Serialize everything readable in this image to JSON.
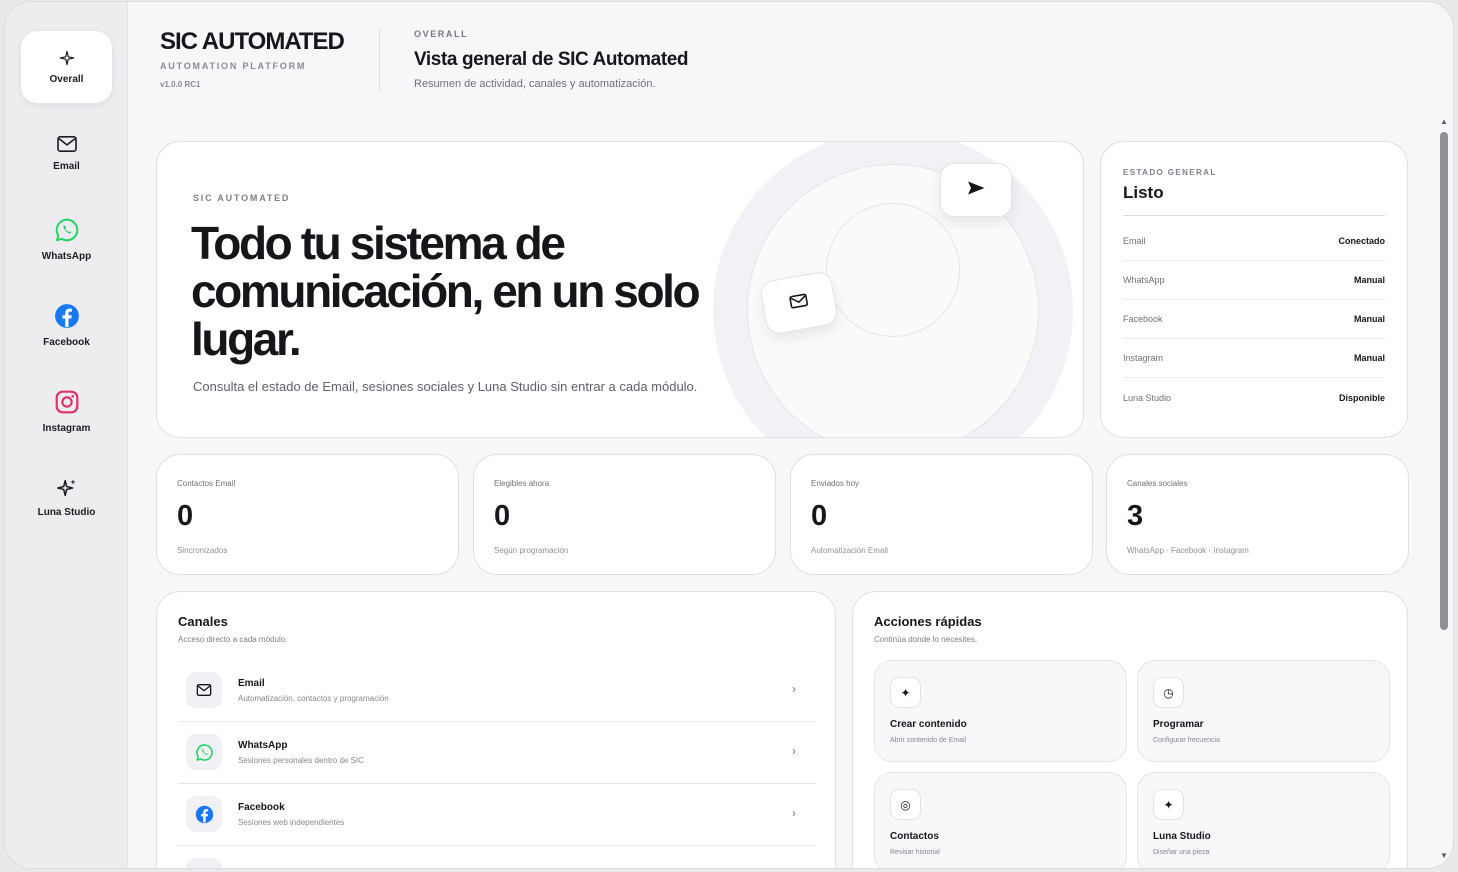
{
  "sidebar": {
    "items": [
      {
        "label": "Overall",
        "icon": "sparkle-icon",
        "active": true
      },
      {
        "label": "Email",
        "icon": "mail-icon"
      },
      {
        "label": "WhatsApp",
        "icon": "whatsapp-icon",
        "color": "#25d366"
      },
      {
        "label": "Facebook",
        "icon": "facebook-icon",
        "color": "#1877f2"
      },
      {
        "label": "Instagram",
        "icon": "instagram-icon",
        "color": "#e1306c"
      },
      {
        "label": "Luna Studio",
        "icon": "stars-icon"
      }
    ]
  },
  "brand": {
    "title": "SIC AUTOMATED",
    "subtitle": "AUTOMATION PLATFORM",
    "version": "v1.0.0 RC1"
  },
  "header": {
    "eyebrow": "OVERALL",
    "title": "Vista general de SIC Automated",
    "description": "Resumen de actividad, canales y automatización."
  },
  "hero": {
    "eyebrow": "SIC AUTOMATED",
    "title": "Todo tu sistema de comunicación, en un solo lugar.",
    "description": "Consulta el estado de Email, sesiones sociales y Luna Studio sin entrar a cada módulo."
  },
  "status": {
    "eyebrow": "ESTADO GENERAL",
    "title": "Listo",
    "rows": [
      {
        "key": "Email",
        "value": "Conectado"
      },
      {
        "key": "WhatsApp",
        "value": "Manual"
      },
      {
        "key": "Facebook",
        "value": "Manual"
      },
      {
        "key": "Instagram",
        "value": "Manual"
      },
      {
        "key": "Luna Studio",
        "value": "Disponible"
      }
    ]
  },
  "stats": [
    {
      "label": "Contactos Email",
      "value": "0",
      "note": "Sincronizados"
    },
    {
      "label": "Elegibles ahora",
      "value": "0",
      "note": "Según programación"
    },
    {
      "label": "Enviados hoy",
      "value": "0",
      "note": "Automatización Email"
    },
    {
      "label": "Canales sociales",
      "value": "3",
      "note": "WhatsApp · Facebook · Instagram"
    }
  ],
  "channels": {
    "title": "Canales",
    "subtitle": "Acceso directo a cada módulo.",
    "items": [
      {
        "name": "Email",
        "description": "Automatización, contactos y programación",
        "icon": "mail-icon"
      },
      {
        "name": "WhatsApp",
        "description": "Sesiones personales dentro de SIC",
        "icon": "whatsapp-icon"
      },
      {
        "name": "Facebook",
        "description": "Sesiones web independientes",
        "icon": "facebook-icon"
      }
    ],
    "chevron": "›"
  },
  "actions": {
    "title": "Acciones rápidas",
    "subtitle": "Continúa donde lo necesites.",
    "items": [
      {
        "name": "Crear contenido",
        "description": "Abrir contenido de Email",
        "glyph": "✦",
        "icon": "sparkle-icon"
      },
      {
        "name": "Programar",
        "description": "Configurar frecuencia",
        "glyph": "◷",
        "icon": "clock-icon"
      },
      {
        "name": "Contactos",
        "description": "Revisar historial",
        "glyph": "◎",
        "icon": "target-icon"
      },
      {
        "name": "Luna Studio",
        "description": "Diseñar una pieza",
        "glyph": "✦",
        "icon": "sparkle-icon"
      }
    ]
  },
  "colors": {
    "accent": "#15171b",
    "whatsapp": "#25d366",
    "facebook": "#1877f2",
    "instagram": "#e1306c"
  }
}
